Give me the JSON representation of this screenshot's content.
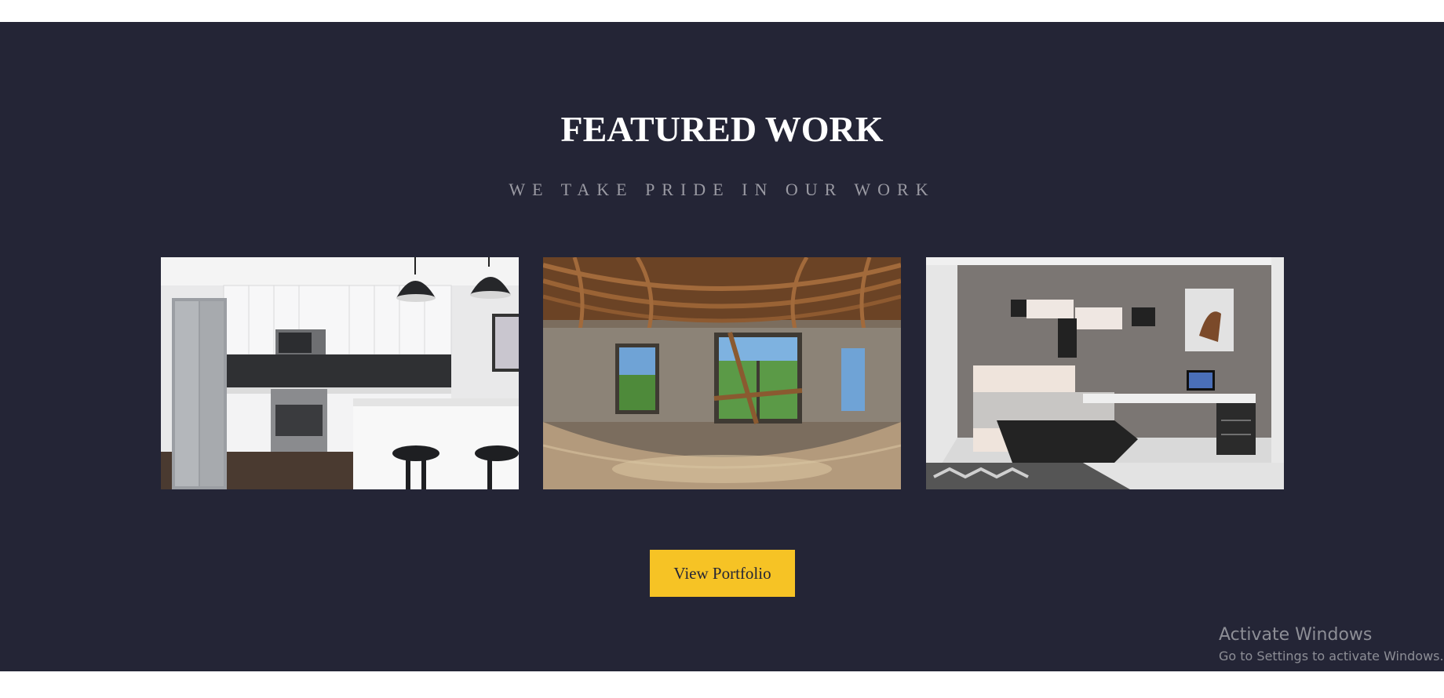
{
  "section": {
    "title": "FEATURED WORK",
    "subtitle": "WE TAKE PRIDE IN OUR WORK",
    "background_color": "#242536"
  },
  "gallery": [
    {
      "subject": "kitchen interior photo"
    },
    {
      "subject": "attic wooden beams panorama photo"
    },
    {
      "subject": "bedroom study 3d render"
    }
  ],
  "cta": {
    "label": "View Portfolio",
    "color": "#f6c325"
  },
  "watermark": {
    "title": "Activate Windows",
    "subtitle": "Go to Settings to activate Windows."
  }
}
